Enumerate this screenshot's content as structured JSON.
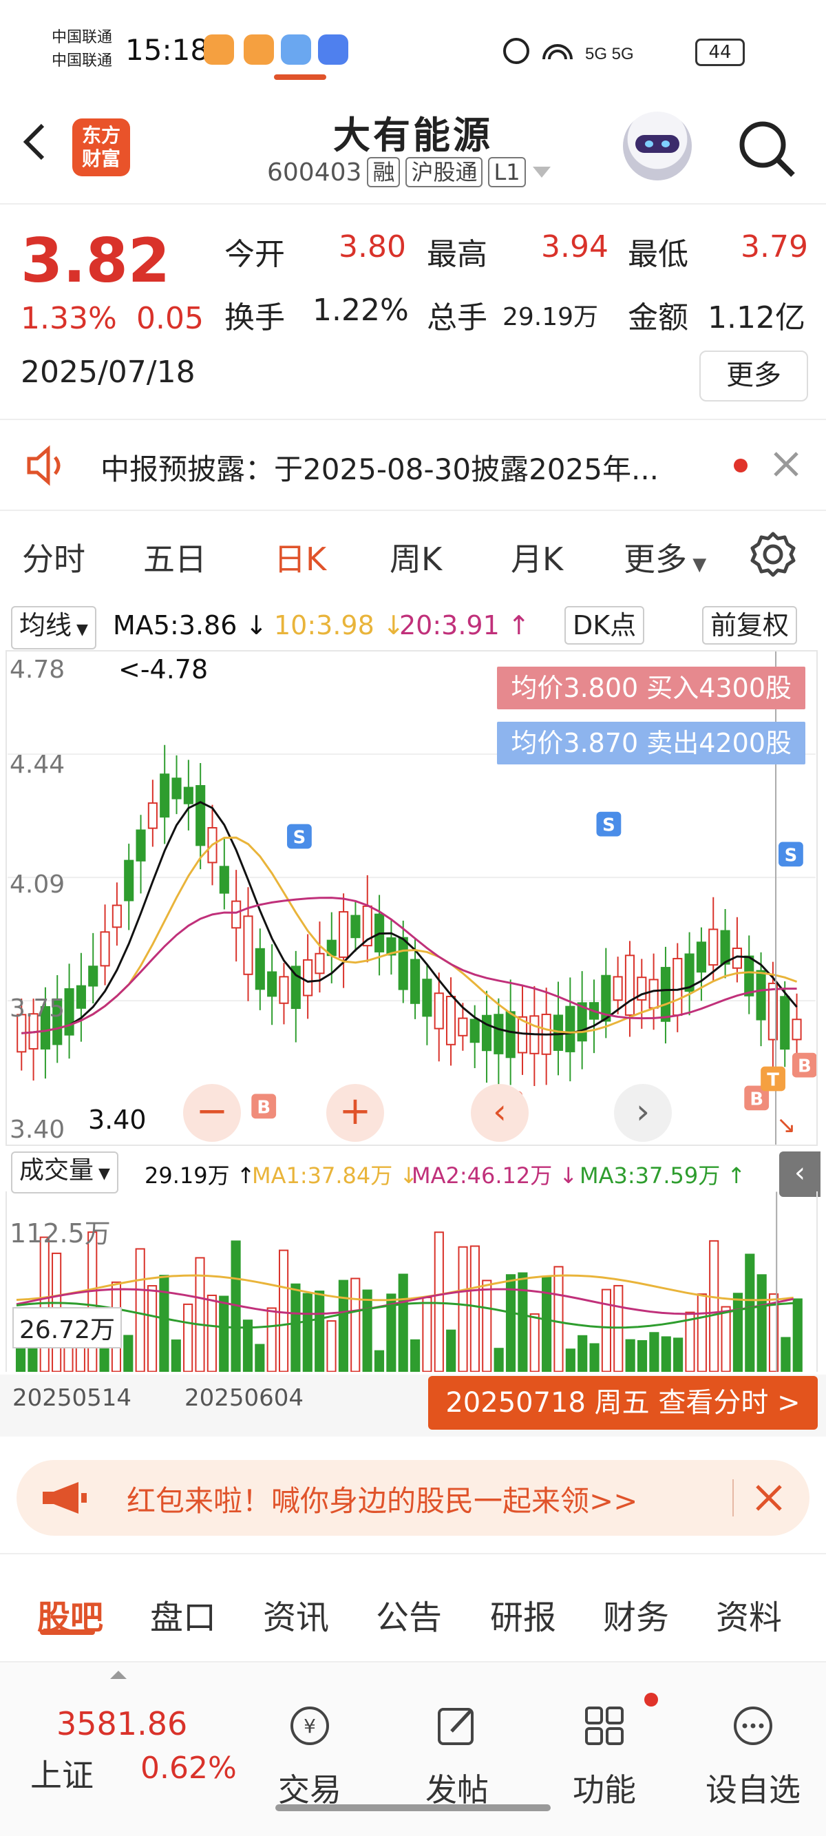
{
  "status_bar": {
    "carrier1": "中国联通",
    "carrier2": "中国联通",
    "time": "15:18",
    "network": "5G 5G",
    "battery": "44"
  },
  "header": {
    "logo_line1": "东方",
    "logo_line2": "财富",
    "title": "大有能源",
    "code": "600403",
    "tag_margin": "融",
    "tag_connect": "沪股通",
    "tag_level": "L1"
  },
  "quote": {
    "price": "3.82",
    "change_pct": "1.33%",
    "change": "0.05",
    "date": "2025/07/18",
    "open_label": "今开",
    "open": "3.80",
    "high_label": "最高",
    "high": "3.94",
    "low_label": "最低",
    "low": "3.79",
    "turnover_label": "换手",
    "turnover": "1.22%",
    "volume_label": "总手",
    "volume": "29.19万",
    "amount_label": "金额",
    "amount": "1.12亿",
    "more_label": "更多"
  },
  "notice": {
    "text": "中报预披露：于2025-08-30披露2025年..."
  },
  "kline_tabs": [
    "分时",
    "五日",
    "日K",
    "周K",
    "月K",
    "更多"
  ],
  "ma_bar": {
    "selector": "均线",
    "ma5": "MA5:3.86 ↓",
    "ma10": "10:3.98 ↓",
    "ma20": "20:3.91 ↑",
    "dk": "DK点",
    "adjust": "前复权"
  },
  "kline": {
    "price_labels": [
      "4.78",
      "4.44",
      "4.09",
      "3.75",
      "3.40"
    ],
    "high_mark": "<-4.78",
    "low_mark": "3.40",
    "buy_box": "均价3.800  买入4300股",
    "sell_box": "均价3.870  卖出4200股",
    "marker_s": "S",
    "marker_b": "B",
    "marker_t": "T",
    "colors": {
      "up": "#d9322a",
      "down": "#2e9d2e",
      "ma5": "#111111",
      "ma10": "#e9b43a",
      "ma20": "#c0307a"
    }
  },
  "volume_bar": {
    "selector": "成交量",
    "vol": "29.19万 ↑",
    "ma1": "MA1:37.84万 ↓",
    "ma2": "MA2:46.12万 ↓",
    "ma3": "MA3:37.59万 ↑",
    "max_label": "112.5万",
    "cursor_label": "26.72万"
  },
  "dates": {
    "d1": "20250514",
    "d2": "20250604",
    "button": "20250718 周五 查看分时 >"
  },
  "promo": {
    "text": "红包来啦！喊你身边的股民一起来领>>"
  },
  "bottom_tabs": [
    "股吧",
    "盘口",
    "资讯",
    "公告",
    "研报",
    "财务",
    "资料"
  ],
  "nav": {
    "index_value": "3581.86",
    "index_name": "上证",
    "index_change": "0.62%",
    "items": [
      "交易",
      "发帖",
      "功能",
      "设自选"
    ]
  }
}
